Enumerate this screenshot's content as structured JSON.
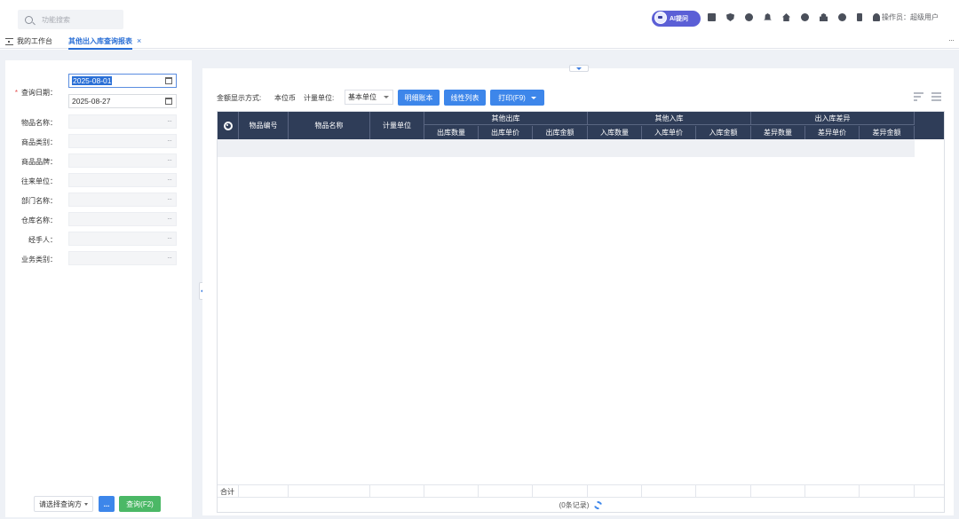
{
  "topbar": {
    "search_placeholder": "功能搜索",
    "ai_button": "AI提问",
    "operator_label": "操作员：超级用户",
    "icons": [
      "message-icon",
      "shield-icon",
      "pie-chart-icon",
      "bell-icon",
      "home-icon",
      "help-icon",
      "lock-icon",
      "refresh-icon",
      "door-icon",
      "user-icon"
    ]
  },
  "tabs": {
    "home": "我的工作台",
    "active": "其他出入库查询报表",
    "close": "×",
    "more": "···"
  },
  "filters": {
    "query_date_label": "查询日期：",
    "date_from": "2025-08-01",
    "date_to": "2025-08-27",
    "dots": "···",
    "fields": [
      {
        "label": "物品名称："
      },
      {
        "label": "商品类别："
      },
      {
        "label": "商品品牌："
      },
      {
        "label": "往来单位："
      },
      {
        "label": "部门名称："
      },
      {
        "label": "仓库名称："
      },
      {
        "label": "经手人："
      },
      {
        "label": "业务类别："
      }
    ],
    "select_scheme": "请选择查询方",
    "dots_button": "...",
    "query_button": "查询(F2)"
  },
  "toolbar": {
    "amount_mode_label": "金额显示方式:",
    "amount_mode_value": "本位币",
    "unit_label": "计量单位:",
    "unit_value": "基本单位",
    "detail_button": "明细账本",
    "linear_button": "线性列表",
    "print_button": "打印(F9)"
  },
  "grid": {
    "columns": {
      "item_code": "物品编号",
      "item_name": "物品名称",
      "unit": "计量单位",
      "other_out": "其他出库",
      "out_qty": "出库数量",
      "out_price": "出库单价",
      "out_amount": "出库金额",
      "other_in": "其他入库",
      "in_qty": "入库数量",
      "in_price": "入库单价",
      "in_amount": "入库金额",
      "diff": "出入库差异",
      "diff_qty": "差异数量",
      "diff_price": "差异单价",
      "diff_amount": "差异金额"
    },
    "total_label": "合计",
    "record_count": "(0条记录)"
  },
  "colors": {
    "primary": "#3d86ea",
    "header_bg": "#2f3d58",
    "query_green": "#4bb866",
    "ai_purple": "#5b5fd6"
  }
}
